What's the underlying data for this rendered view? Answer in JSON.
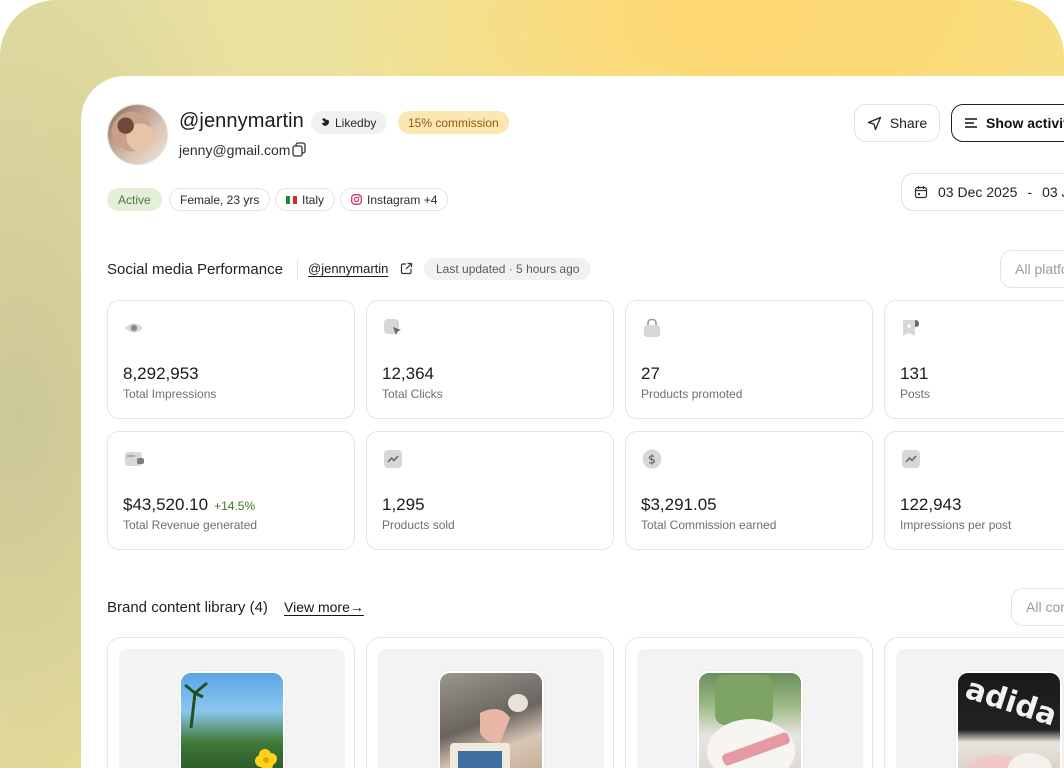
{
  "profile": {
    "username": "@jennymartin",
    "platform_badge": "Likedby",
    "commission_badge": "15% commission",
    "email": "jenny@gmail.com",
    "chips": {
      "status": "Active",
      "demographic": "Female, 23 yrs",
      "country": "Italy",
      "platforms": "Instagram +4"
    }
  },
  "actions": {
    "share_label": "Share",
    "activity_label": "Show activity",
    "date_start": "03 Dec 2025",
    "date_separator": "-",
    "date_end_partial": "03 J"
  },
  "social": {
    "title": "Social media Performance",
    "handle": "@jennymartin",
    "last_updated": "Last updated · 5 hours ago",
    "filter_placeholder": "All platfo",
    "metrics": [
      {
        "icon": "eye-icon",
        "value": "8,292,953",
        "label": "Total Impressions"
      },
      {
        "icon": "cursor-click-icon",
        "value": "12,364",
        "label": "Total Clicks"
      },
      {
        "icon": "shopping-bag-icon",
        "value": "27",
        "label": "Products promoted"
      },
      {
        "icon": "post-add-icon",
        "value": "131",
        "label": "Posts"
      },
      {
        "icon": "wallet-icon",
        "value": "$43,520.10",
        "delta": "+14.5%",
        "label": "Total Revenue generated"
      },
      {
        "icon": "trend-icon",
        "value": "1,295",
        "label": "Products sold"
      },
      {
        "icon": "dollar-coin-icon",
        "value": "$3,291.05",
        "label": "Total Commission earned"
      },
      {
        "icon": "trend-icon",
        "value": "122,943",
        "label": "Impressions per post"
      }
    ]
  },
  "brand_library": {
    "title": "Brand content library (4)",
    "view_more": "View more→",
    "filter_placeholder": "All con"
  },
  "colors": {
    "active_green_bg": "#e3efda",
    "commission_bg": "#fde7b0",
    "delta_green": "#3d7a2c"
  }
}
